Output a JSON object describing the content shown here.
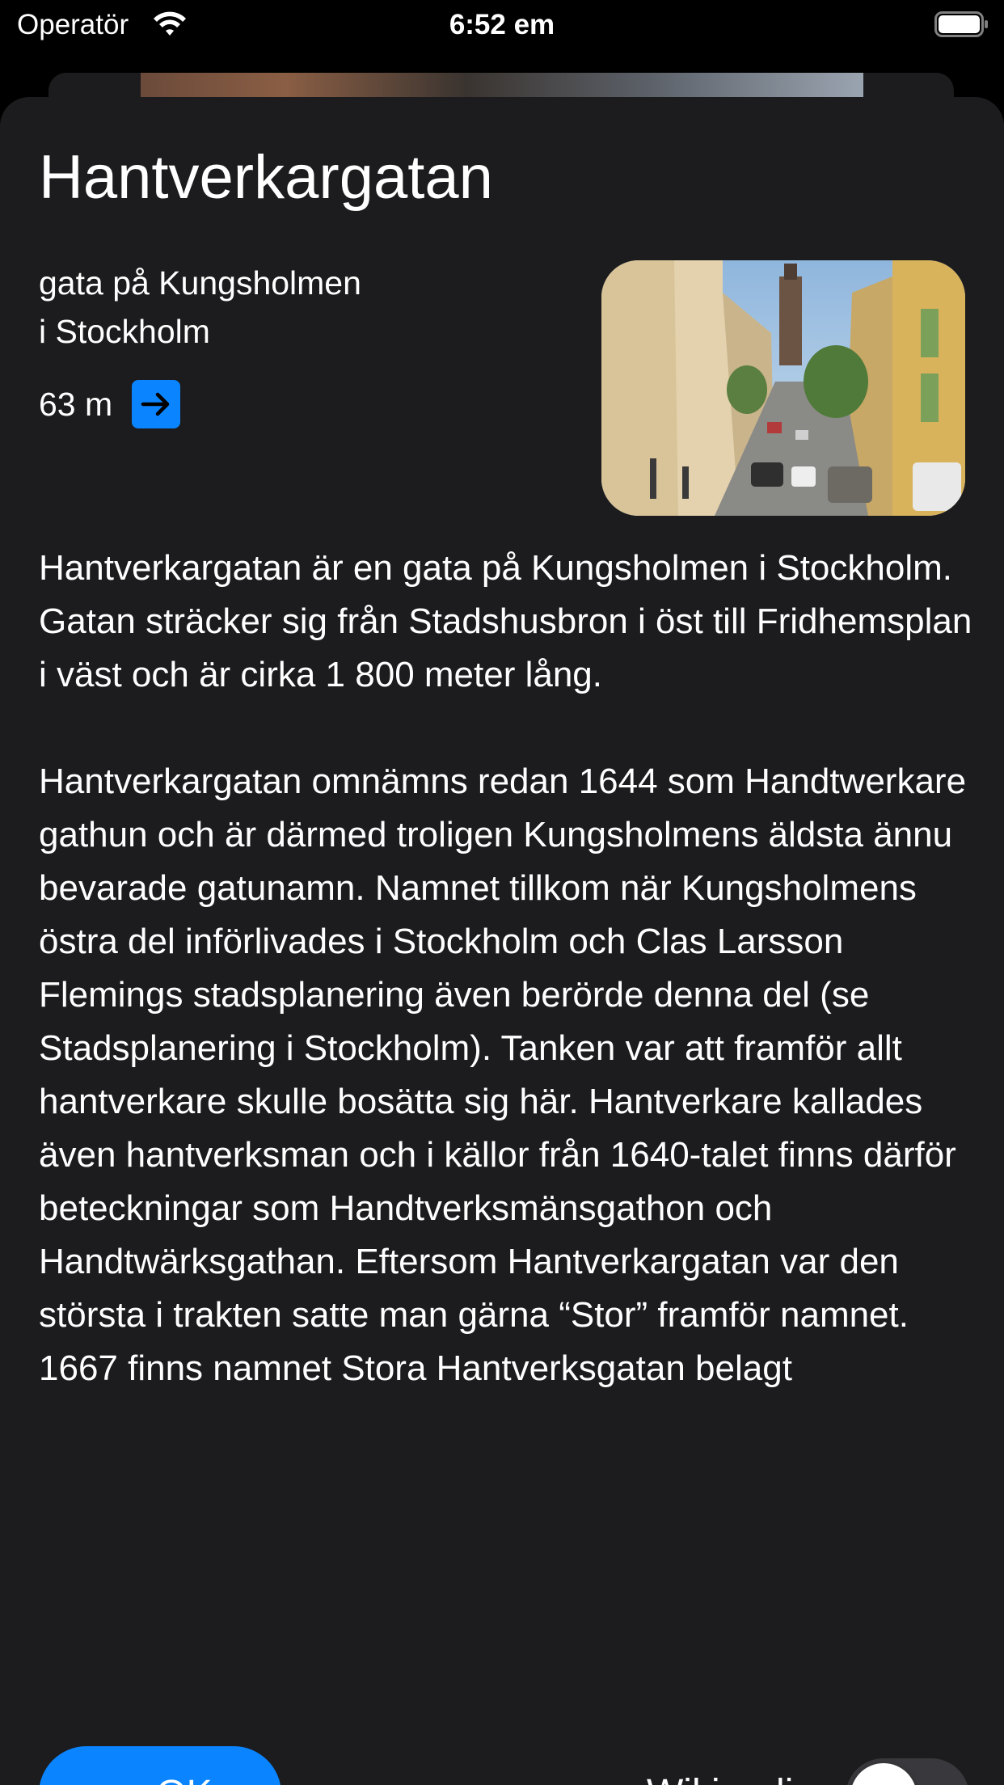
{
  "status_bar": {
    "carrier": "Operatör",
    "time": "6:52 em",
    "wifi_icon": "wifi-icon",
    "battery_icon": "battery-icon"
  },
  "place": {
    "title": "Hantverkargatan",
    "subtitle_line1": "gata på Kungsholmen",
    "subtitle_line2": "i Stockholm",
    "distance": "63 m",
    "direction_icon": "arrow-right-icon"
  },
  "description": {
    "paragraphs": [
      "Hantverkargatan är en gata på Kungsholmen i Stockholm. Gatan sträcker sig från Stadshusbron i öst till Fridhemsplan i väst och är cirka 1 800 meter lång.",
      "Hantverkargatan omnämns redan 1644 som Handtwerkare gathun och är därmed troligen Kungsholmens äldsta ännu bevarade gatunamn. Namnet tillkom när Kungsholmens östra del införlivades i Stockholm och Clas Larsson Flemings stadsplanering även berörde denna del (se Stadsplanering i Stockholm). Tanken var att framför allt hantverkare skulle bosätta sig här. Hantverkare kallades även hantverksman och i källor från 1640-talet finns därför beteckningar som Handtverksmänsgathon och Handtwärksgathan. Eftersom Hantverkargatan var den största i trakten satte man gärna “Stor” framför namnet. 1667 finns namnet Stora Hantverksgatan belagt"
    ]
  },
  "footer": {
    "ok_label": "OK",
    "ok_icon": "chevron-down-icon",
    "wikipedia_label": "Wikipedia",
    "wikipedia_enabled": false
  },
  "colors": {
    "accent": "#0a84ff",
    "sheet_bg": "#1c1c1e",
    "toggle_off": "#39393d"
  }
}
